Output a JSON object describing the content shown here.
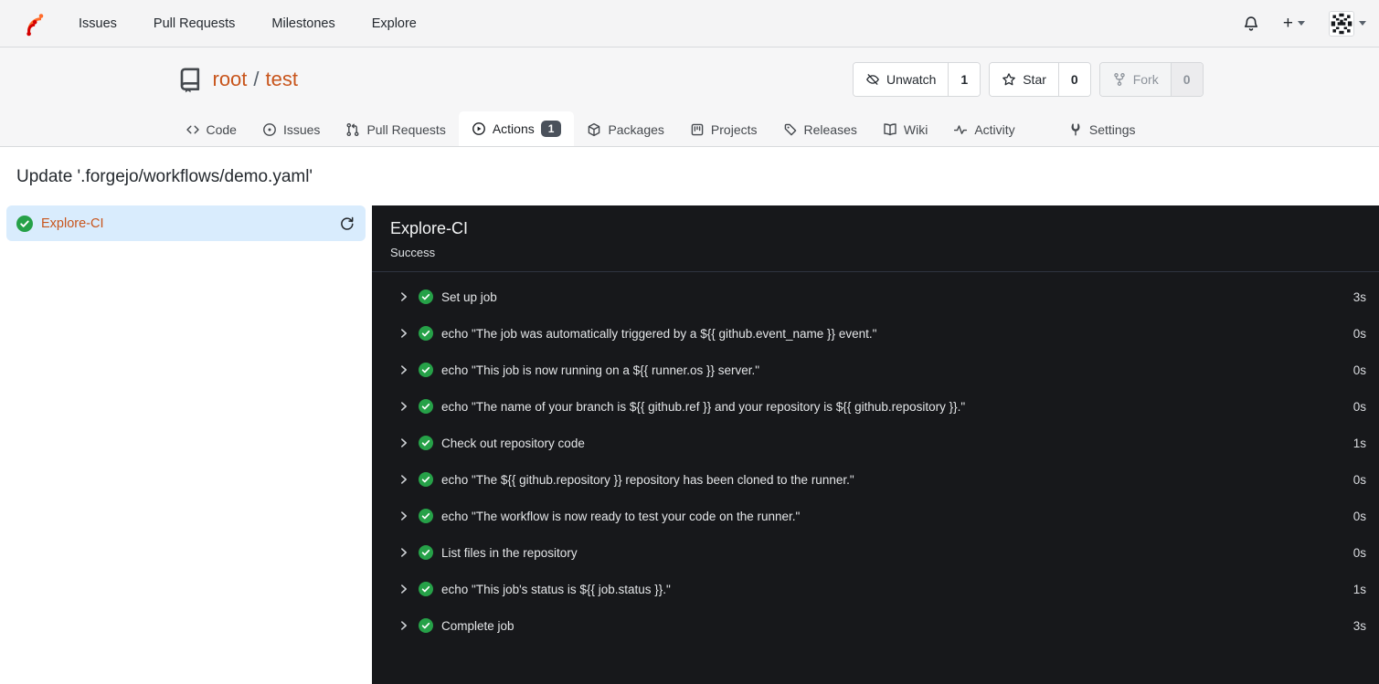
{
  "navbar": {
    "items": [
      {
        "label": "Issues"
      },
      {
        "label": "Pull Requests"
      },
      {
        "label": "Milestones"
      },
      {
        "label": "Explore"
      }
    ]
  },
  "repo": {
    "owner": "root",
    "separator": "/",
    "name": "test",
    "actions": [
      {
        "label": "Unwatch",
        "count": "1"
      },
      {
        "label": "Star",
        "count": "0"
      },
      {
        "label": "Fork",
        "count": "0",
        "disabled": true
      }
    ]
  },
  "tabs": [
    {
      "label": "Code"
    },
    {
      "label": "Issues"
    },
    {
      "label": "Pull Requests"
    },
    {
      "label": "Actions",
      "badge": "1",
      "active": true
    },
    {
      "label": "Packages"
    },
    {
      "label": "Projects"
    },
    {
      "label": "Releases"
    },
    {
      "label": "Wiki"
    },
    {
      "label": "Activity"
    },
    {
      "label": "Settings"
    }
  ],
  "page": {
    "title": "Update '.forgejo/workflows/demo.yaml'"
  },
  "sidebar": {
    "job": {
      "label": "Explore-CI",
      "status": "success"
    }
  },
  "panel": {
    "title": "Explore-CI",
    "status": "Success",
    "steps": [
      {
        "label": "Set up job",
        "duration": "3s"
      },
      {
        "label": "echo \"The job was automatically triggered by a ${{ github.event_name }} event.\"",
        "duration": "0s"
      },
      {
        "label": "echo \"This job is now running on a ${{ runner.os }} server.\"",
        "duration": "0s"
      },
      {
        "label": "echo \"The name of your branch is ${{ github.ref }} and your repository is ${{ github.repository }}.\"",
        "duration": "0s"
      },
      {
        "label": "Check out repository code",
        "duration": "1s"
      },
      {
        "label": "echo \"The ${{ github.repository }} repository has been cloned to the runner.\"",
        "duration": "0s"
      },
      {
        "label": "echo \"The workflow is now ready to test your code on the runner.\"",
        "duration": "0s"
      },
      {
        "label": "List files in the repository",
        "duration": "0s"
      },
      {
        "label": "echo \"This job's status is ${{ job.status }}.\"",
        "duration": "1s"
      },
      {
        "label": "Complete job",
        "duration": "3s"
      }
    ]
  },
  "colors": {
    "accent_orange": "#c8551c",
    "success_green": "#26a148",
    "panel_dark": "#17181b",
    "selected_job_bg": "#d9ecfd",
    "header_gray": "#f4f4f5",
    "badge_bg": "#4a515b"
  }
}
